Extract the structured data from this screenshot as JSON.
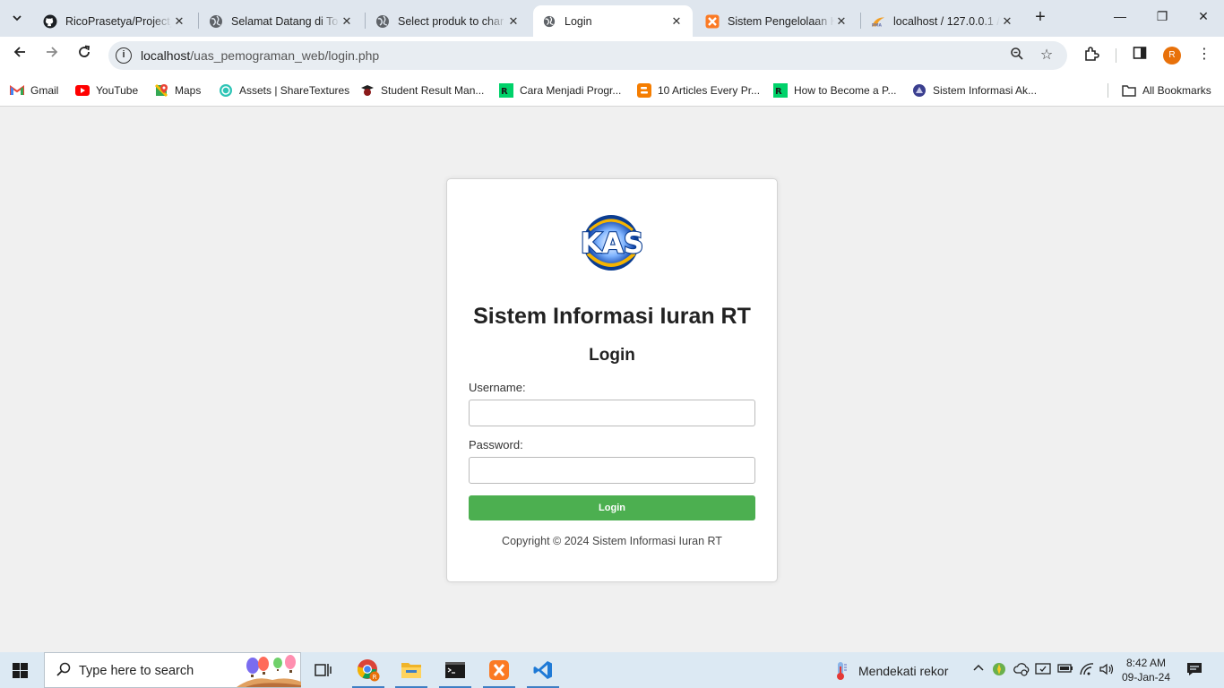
{
  "browser": {
    "tabs": [
      {
        "title": "RicoPrasetya/Project_",
        "icon": "github-icon"
      },
      {
        "title": "Selamat Datang di To",
        "icon": "globe-icon"
      },
      {
        "title": "Select produk to char",
        "icon": "globe-icon"
      },
      {
        "title": "Login",
        "icon": "globe-icon",
        "active": true
      },
      {
        "title": "Sistem Pengelolaan K",
        "icon": "xampp-icon"
      },
      {
        "title": "localhost / 127.0.0.1 /",
        "icon": "phpmyadmin-icon"
      }
    ],
    "url_host": "localhost",
    "url_path": "/uas_pemograman_web/login.php",
    "profile_initial": "R",
    "bookmarks": [
      {
        "label": "Gmail",
        "icon": "gmail-icon"
      },
      {
        "label": "YouTube",
        "icon": "youtube-icon"
      },
      {
        "label": "Maps",
        "icon": "maps-icon"
      },
      {
        "label": "Assets | ShareTextures",
        "icon": "sharetextures-icon"
      },
      {
        "label": "Student Result Man...",
        "icon": "student-icon"
      },
      {
        "label": "Cara Menjadi Progr...",
        "icon": "dicoding-icon"
      },
      {
        "label": "10 Articles Every Pr...",
        "icon": "blogger-icon"
      },
      {
        "label": "How to Become a P...",
        "icon": "dicoding-icon"
      },
      {
        "label": "Sistem Informasi Ak...",
        "icon": "campus-icon"
      }
    ],
    "all_bookmarks": "All Bookmarks"
  },
  "page": {
    "logo_text": "KAS",
    "app_title": "Sistem Informasi Iuran RT",
    "login_heading": "Login",
    "username_label": "Username:",
    "username_value": "",
    "password_label": "Password:",
    "password_value": "",
    "login_button": "Login",
    "copyright": "Copyright © 2024 Sistem Informasi Iuran RT"
  },
  "taskbar": {
    "search_placeholder": "Type here to search",
    "weather_text": "Mendekati rekor",
    "time": "8:42 AM",
    "date": "09-Jan-24"
  },
  "colors": {
    "login_button": "#4caf50",
    "page_bg": "#f0f0f0",
    "tabbar_bg": "#dfe6ee",
    "taskbar_bg": "#dce9f3"
  }
}
